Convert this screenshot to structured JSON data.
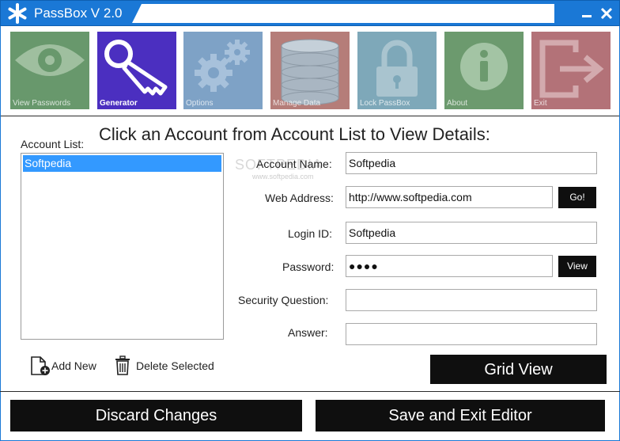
{
  "app": {
    "title": "PassBox V 2.0"
  },
  "toolbar": {
    "tiles": [
      {
        "label": "View Passwords",
        "color": "#68986c"
      },
      {
        "label": "Generator",
        "color": "#4b2fc0"
      },
      {
        "label": "Options",
        "color": "#7ea2c6"
      },
      {
        "label": "Manage Data",
        "color": "#b57d79"
      },
      {
        "label": "Lock PassBox",
        "color": "#7ea8b9"
      },
      {
        "label": "About",
        "color": "#6c9a6e"
      },
      {
        "label": "Exit",
        "color": "#b37278"
      }
    ]
  },
  "main": {
    "heading": "Click an Account from Account List to View Details:",
    "account_list_label": "Account List:",
    "accounts": [
      "Softpedia"
    ],
    "fields": {
      "account_name": {
        "label": "Account Name:",
        "value": "Softpedia"
      },
      "web_address": {
        "label": "Web Address:",
        "value": "http://www.softpedia.com"
      },
      "login_id": {
        "label": "Login ID:",
        "value": "Softpedia"
      },
      "password": {
        "label": "Password:",
        "value": "●●●●"
      },
      "security_question": {
        "label": "Security Question:",
        "value": ""
      },
      "answer": {
        "label": "Answer:",
        "value": ""
      }
    },
    "go_button": "Go!",
    "view_button": "View",
    "add_new": "Add New",
    "delete_selected": "Delete Selected",
    "grid_view": "Grid View"
  },
  "watermark": {
    "text": "SOFTPEDIA",
    "sub": "www.softpedia.com"
  },
  "footer": {
    "discard": "Discard Changes",
    "save_exit": "Save and Exit Editor"
  },
  "colors": {
    "titlebar": "#1a78d6",
    "selection": "#3399ff",
    "button": "#0f0f0f"
  }
}
